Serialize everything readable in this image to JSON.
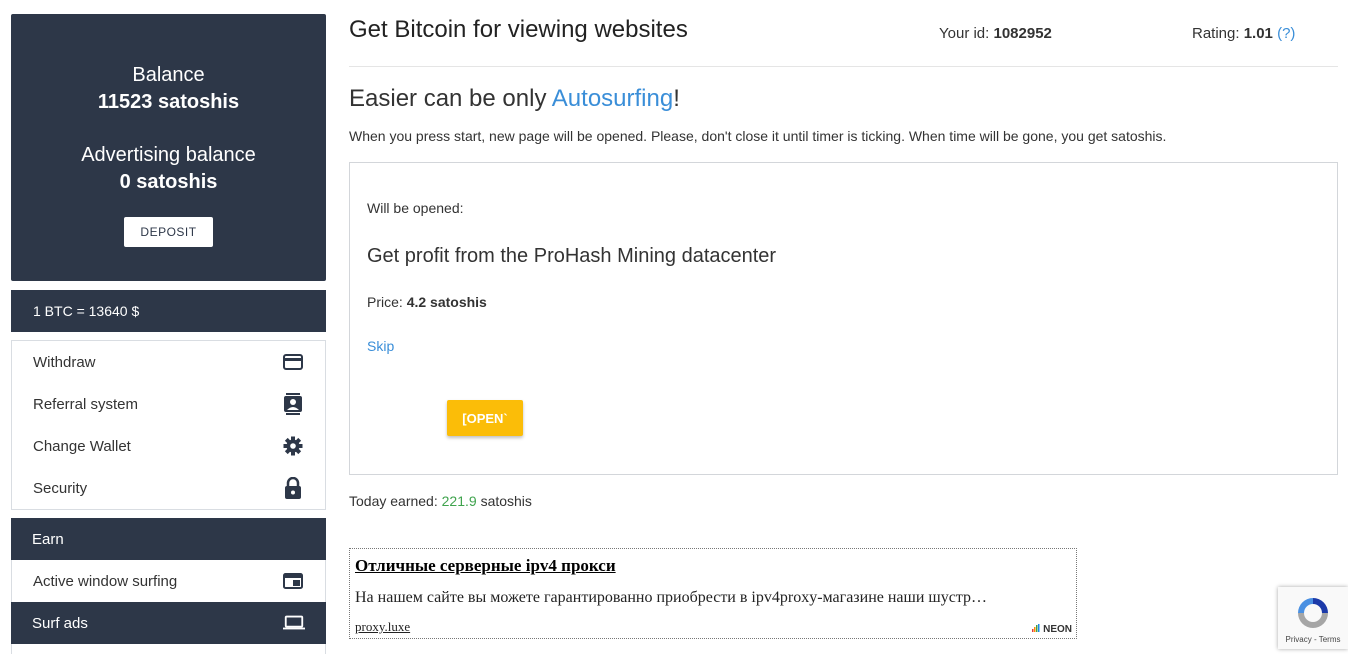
{
  "sidebar": {
    "balance_label": "Balance",
    "balance_value": "11523 satoshis",
    "adv_label": "Advertising balance",
    "adv_value": "0 satoshis",
    "deposit": "DEPOSIT",
    "rate": "1 BTC = 13640 $",
    "menu": [
      {
        "label": "Withdraw",
        "icon": "credit-card-icon"
      },
      {
        "label": "Referral system",
        "icon": "contact-card-icon"
      },
      {
        "label": "Change Wallet",
        "icon": "gear-icon"
      },
      {
        "label": "Security",
        "icon": "lock-icon"
      }
    ],
    "earn": "Earn",
    "active_surf": "Active window surfing",
    "surf_ads": "Surf ads"
  },
  "header": {
    "title": "Get Bitcoin for viewing websites",
    "id_label": "Your id:",
    "id_value": "1082952",
    "rating_label": "Rating:",
    "rating_value": "1.01",
    "rating_help": "(?)"
  },
  "main": {
    "sub_pre": "Easier can be only ",
    "sub_link": "Autosurfing",
    "sub_post": "!",
    "desc": "When you press start, new page will be opened. Please, don't close it until timer is ticking. When time will be gone, you get satoshis.",
    "will_be_opened": "Will be opened:",
    "page_title": "Get profit from the ProHash Mining datacenter",
    "price_label": "Price:",
    "price_value": "4.2 satoshis",
    "skip": "Skip",
    "open": "[OPEN`",
    "today_label": "Today earned:",
    "today_value": "221.9",
    "today_unit": "satoshis"
  },
  "ad": {
    "title": "Отличные серверные ipv4 прокси",
    "desc": "На нашем сайте вы можете гарантированно приобрести в ipv4proxy-магазине наши шустр…",
    "link": "proxy.luxe",
    "brand": "NEON"
  },
  "recaptcha": {
    "terms": "Privacy - Terms"
  },
  "colors": {
    "dark": "#2d3748",
    "accent": "#3a8ed8",
    "button": "#fbbd08",
    "green": "#3fa34d"
  }
}
